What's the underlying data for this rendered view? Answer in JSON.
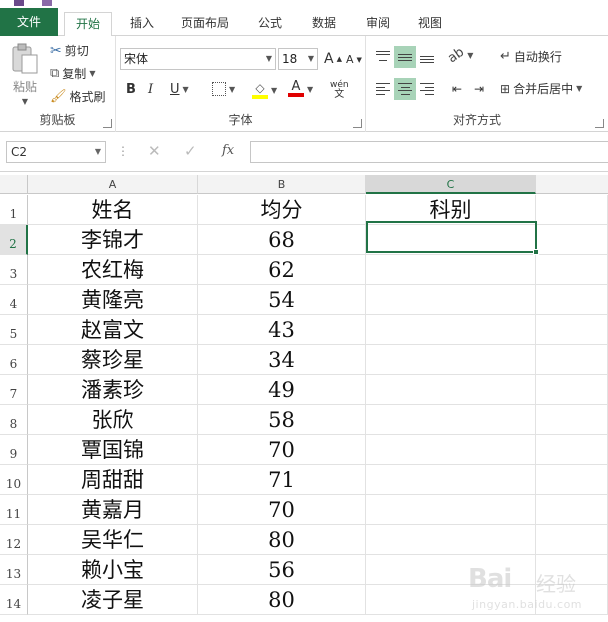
{
  "tabs": {
    "file": "文件",
    "items": [
      "开始",
      "插入",
      "页面布局",
      "公式",
      "数据",
      "审阅",
      "视图"
    ],
    "active": "开始"
  },
  "ribbon": {
    "clipboard": {
      "label": "剪贴板",
      "paste": "粘贴",
      "cut": "剪切",
      "copy": "复制",
      "format_painter": "格式刷"
    },
    "font": {
      "label": "字体",
      "font_name": "宋体",
      "font_size": "18",
      "bold": "B",
      "italic": "I",
      "underline": "U",
      "grow": "A",
      "shrink": "A",
      "wen": "wén"
    },
    "alignment": {
      "label": "对齐方式",
      "wrap_text": "自动换行",
      "merge_center": "合并后居中"
    }
  },
  "formula_bar": {
    "name_box": "C2",
    "fx": "fx",
    "value": ""
  },
  "sheet": {
    "columns": [
      "A",
      "B",
      "C"
    ],
    "rows": [
      {
        "n": "1",
        "a": "姓名",
        "b": "均分",
        "c": "科别"
      },
      {
        "n": "2",
        "a": "李锦才",
        "b": "68",
        "c": ""
      },
      {
        "n": "3",
        "a": "农红梅",
        "b": "62",
        "c": ""
      },
      {
        "n": "4",
        "a": "黄隆亮",
        "b": "54",
        "c": ""
      },
      {
        "n": "5",
        "a": "赵富文",
        "b": "43",
        "c": ""
      },
      {
        "n": "6",
        "a": "蔡珍星",
        "b": "34",
        "c": ""
      },
      {
        "n": "7",
        "a": "潘素珍",
        "b": "49",
        "c": ""
      },
      {
        "n": "8",
        "a": "张欣",
        "b": "58",
        "c": ""
      },
      {
        "n": "9",
        "a": "覃国锦",
        "b": "70",
        "c": ""
      },
      {
        "n": "10",
        "a": "周甜甜",
        "b": "71",
        "c": ""
      },
      {
        "n": "11",
        "a": "黄嘉月",
        "b": "70",
        "c": ""
      },
      {
        "n": "12",
        "a": "吴华仁",
        "b": "80",
        "c": ""
      },
      {
        "n": "13",
        "a": "赖小宝",
        "b": "56",
        "c": ""
      },
      {
        "n": "14",
        "a": "凌子星",
        "b": "80",
        "c": ""
      }
    ],
    "selected_cell": "C2",
    "selected_column": "C",
    "selected_row": "2"
  },
  "watermark": {
    "brand": "Bai",
    "brand_cn": "经验",
    "url": "jingyan.baidu.com"
  },
  "colors": {
    "accent": "#217346",
    "selection_fill": "#a8d3b8"
  }
}
